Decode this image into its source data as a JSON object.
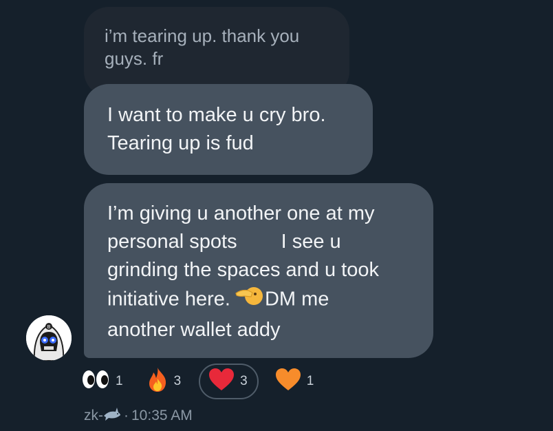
{
  "messages": {
    "quoted": {
      "line1": "i’m tearing up. thank you",
      "line2": "guys. fr"
    },
    "first": {
      "line1": "I want to make u cry bro.",
      "line2": "Tearing up is fud"
    },
    "second": {
      "line1": "I’m giving u another one at my",
      "line2_a": "personal spots",
      "line2_b": "I see u",
      "line3": "grinding the spaces and u took",
      "line4_a": "initiative here.",
      "line4_b": "DM me",
      "line5": "another wallet addy"
    }
  },
  "reactions": [
    {
      "icon": "eyes-icon",
      "count": "1"
    },
    {
      "icon": "fire-icon",
      "count": "3"
    },
    {
      "icon": "red-heart-icon",
      "count": "3",
      "selected": true
    },
    {
      "icon": "orange-heart-icon",
      "count": "1"
    }
  ],
  "meta": {
    "sender": "zk-",
    "separator": "·",
    "time": "10:35 AM"
  },
  "colors": {
    "background": "#15202b",
    "bubble": "#46525f",
    "quoted_bubble": "#1f2731",
    "meta_text": "#8b98a5"
  }
}
